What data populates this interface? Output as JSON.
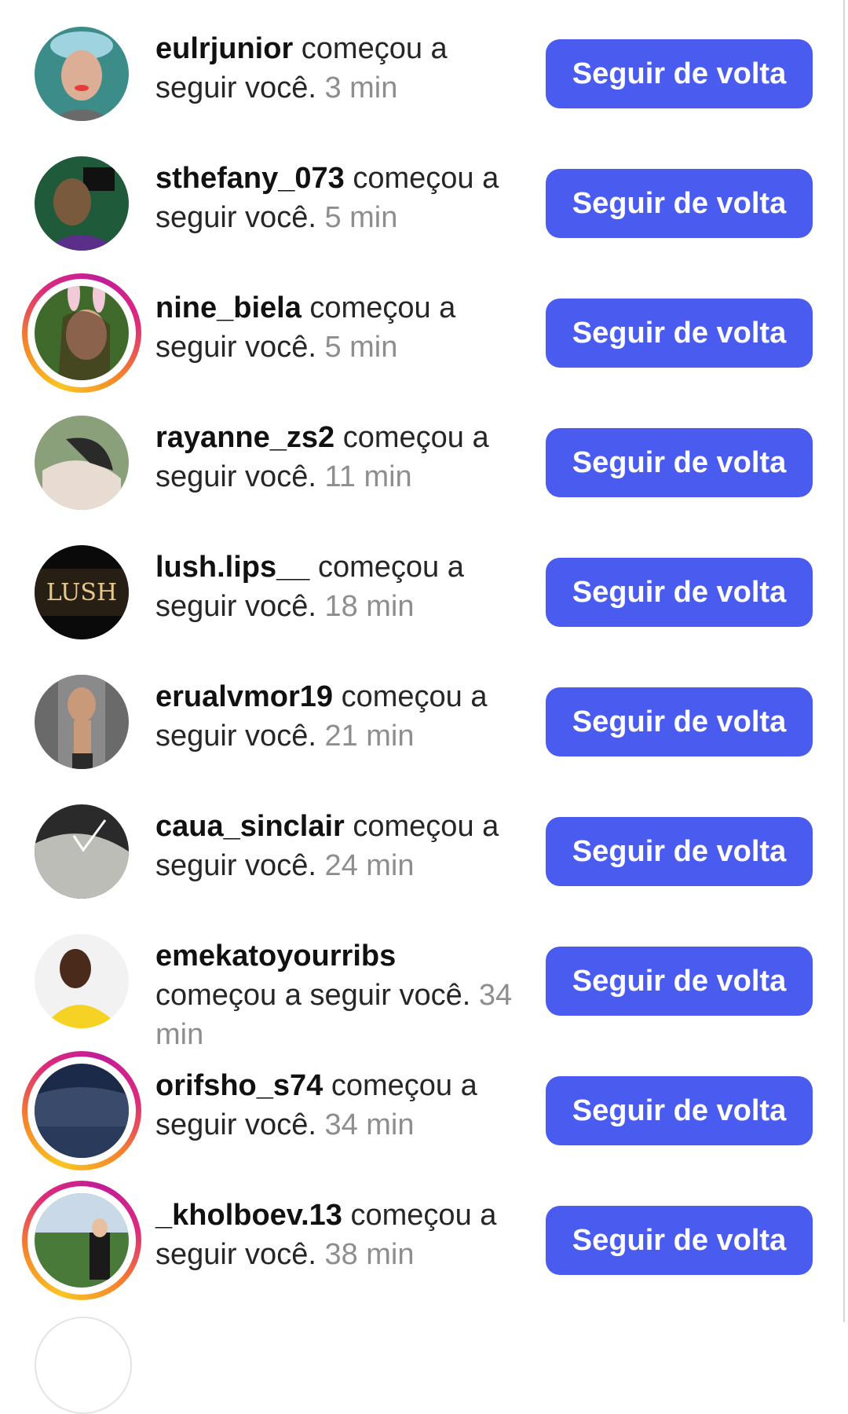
{
  "notifications": [
    {
      "username": "eulrjunior",
      "action": " começou a seguir você.",
      "time": " 3 min",
      "button": "Seguir de volta",
      "story": false,
      "avatar_colors": [
        "#3c8d8a",
        "#dcae96",
        "#e63c3c"
      ]
    },
    {
      "username": "sthefany_073",
      "action": " começou a seguir você.",
      "time": " 5 min",
      "button": "Seguir de volta",
      "story": false,
      "avatar_colors": [
        "#1f5a3a",
        "#7a5a3c",
        "#5b2e8a"
      ]
    },
    {
      "username": "nine_biela",
      "action": " começou a seguir você.",
      "time": " 5 min",
      "button": "Seguir de volta",
      "story": true,
      "avatar_colors": [
        "#3f6a2c",
        "#d9a98a",
        "#f2c9d9"
      ]
    },
    {
      "username": "rayanne_zs2",
      "action": " começou a seguir você.",
      "time": " 11 min",
      "button": "Seguir de volta",
      "story": false,
      "avatar_colors": [
        "#8aa07a",
        "#e8dcd2",
        "#2a2a2a"
      ]
    },
    {
      "username": "lush.lips__",
      "action": " começou a seguir você.",
      "time": " 18 min",
      "button": "Seguir de volta",
      "story": false,
      "avatar_colors": [
        "#0a0a0a",
        "#3a2c1a",
        "#e8c98a"
      ],
      "avatar_text": "LUSH"
    },
    {
      "username": "erualvmor19",
      "action": " começou a seguir você.",
      "time": " 21 min",
      "button": "Seguir de volta",
      "story": false,
      "avatar_colors": [
        "#6a6a6a",
        "#c99a7a",
        "#2a2a2a"
      ]
    },
    {
      "username": "caua_sinclair",
      "action": " começou a seguir você.",
      "time": " 24 min",
      "button": "Seguir de volta",
      "story": false,
      "avatar_colors": [
        "#2a2a2a",
        "#bdbdb8",
        "#e8e8e2"
      ]
    },
    {
      "username": "emekatoyourribs",
      "action": " começou a seguir você.",
      "time": " 34 min",
      "button": "Seguir de volta",
      "story": false,
      "avatar_colors": [
        "#f2f2f2",
        "#4a2a1a",
        "#f5d224"
      ]
    },
    {
      "username": "orifsho_s74",
      "action": " começou a seguir você.",
      "time": " 34 min",
      "button": "Seguir de volta",
      "story": true,
      "avatar_colors": [
        "#1c2a4a",
        "#3a4a6a",
        "#2a3a5a"
      ]
    },
    {
      "username": "_kholboev.13",
      "action": " começou a seguir você.",
      "time": " 38 min",
      "button": "Seguir de volta",
      "story": true,
      "avatar_colors": [
        "#4a7a3a",
        "#c9d9e8",
        "#1a1a1a"
      ]
    }
  ]
}
